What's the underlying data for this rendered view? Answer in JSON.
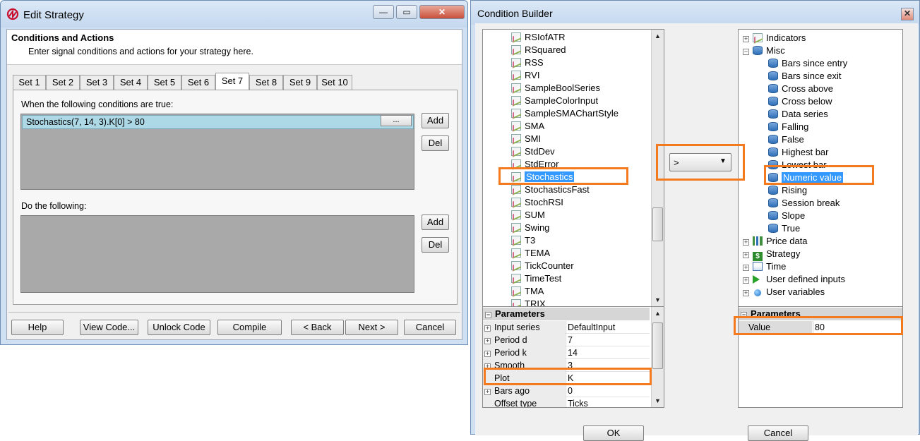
{
  "edit_strategy": {
    "title": "Edit Strategy",
    "header_title": "Conditions and Actions",
    "header_subtitle": "Enter signal conditions and actions for your strategy here.",
    "tabs": [
      "Set 1",
      "Set 2",
      "Set 3",
      "Set 4",
      "Set 5",
      "Set 6",
      "Set 7",
      "Set 8",
      "Set 9",
      "Set 10"
    ],
    "selected_tab": "Set 7",
    "conditions_label": "When the following conditions are true:",
    "condition": "Stochastics(7, 14, 3).K[0] > 80",
    "ellipsis_label": "...",
    "add_label": "Add",
    "del_label": "Del",
    "actions_label": "Do the following:",
    "buttons": {
      "help": "Help",
      "view_code": "View Code...",
      "unlock_code": "Unlock Code",
      "compile": "Compile",
      "back": "< Back",
      "next": "Next >",
      "cancel": "Cancel"
    },
    "window_controls": {
      "minimize": "—",
      "maximize": "▭",
      "close": "✕"
    }
  },
  "condition_builder": {
    "title": "Condition Builder",
    "close_glyph": "✕",
    "left_tree": [
      {
        "label": "RSIofATR"
      },
      {
        "label": "RSquared"
      },
      {
        "label": "RSS"
      },
      {
        "label": "RVI"
      },
      {
        "label": "SampleBoolSeries"
      },
      {
        "label": "SampleColorInput"
      },
      {
        "label": "SampleSMAChartStyle"
      },
      {
        "label": "SMA"
      },
      {
        "label": "SMI"
      },
      {
        "label": "StdDev"
      },
      {
        "label": "StdError"
      },
      {
        "label": "Stochastics",
        "selected": true
      },
      {
        "label": "StochasticsFast"
      },
      {
        "label": "StochRSI"
      },
      {
        "label": "SUM"
      },
      {
        "label": "Swing"
      },
      {
        "label": "T3"
      },
      {
        "label": "TEMA"
      },
      {
        "label": "TickCounter"
      },
      {
        "label": "TimeTest"
      },
      {
        "label": "TMA"
      },
      {
        "label": "TRIX"
      }
    ],
    "operator": ">",
    "right_tree": {
      "indicators": "Indicators",
      "misc": "Misc",
      "misc_items": [
        "Bars since entry",
        "Bars since exit",
        "Cross above",
        "Cross below",
        "Data series",
        "Falling",
        "False",
        "Highest bar",
        "Lowest bar",
        "Numeric value",
        "Rising",
        "Session break",
        "Slope",
        "True"
      ],
      "selected_misc": "Numeric value",
      "others": [
        {
          "label": "Price data",
          "icon": "chart-icon"
        },
        {
          "label": "Strategy",
          "icon": "dollar-icon"
        },
        {
          "label": "Time",
          "icon": "calendar-icon"
        },
        {
          "label": "User defined inputs",
          "icon": "play-icon"
        },
        {
          "label": "User variables",
          "icon": "ball-icon"
        }
      ]
    },
    "left_params": {
      "header": "Parameters",
      "rows": [
        {
          "name": "Input series",
          "value": "DefaultInput",
          "expandable": true
        },
        {
          "name": "Period d",
          "value": "7",
          "expandable": true
        },
        {
          "name": "Period k",
          "value": "14",
          "expandable": true
        },
        {
          "name": "Smooth",
          "value": "3",
          "expandable": true
        },
        {
          "name": "Plot",
          "value": "K",
          "expandable": false
        },
        {
          "name": "Bars ago",
          "value": "0",
          "expandable": true
        },
        {
          "name": "Offset type",
          "value": "Ticks",
          "expandable": false
        }
      ]
    },
    "right_params": {
      "header": "Parameters",
      "value_name": "Value",
      "value": "80"
    },
    "ok_label": "OK",
    "cancel_label": "Cancel"
  }
}
